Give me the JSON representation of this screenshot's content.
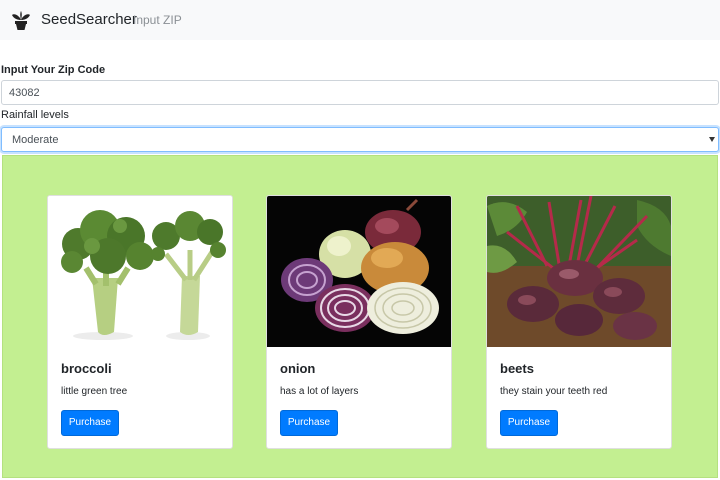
{
  "app": {
    "brand_name": "SeedSearcher",
    "brand_icon": "potted-plant-icon",
    "nav_link": "Input ZIP"
  },
  "form": {
    "zip_label": "Input Your Zip Code",
    "zip_value": "43082",
    "rainfall_label": "Rainfall levels",
    "rainfall_selected": "Moderate"
  },
  "colors": {
    "results_background": "#c3ef91",
    "button": "#007bff",
    "navbar": "#f8f9fa"
  },
  "cards": [
    {
      "title": "broccoli",
      "description": "little green tree",
      "button_label": "Purchase",
      "image": "broccoli-photo"
    },
    {
      "title": "onion",
      "description": "has a lot of layers",
      "button_label": "Purchase",
      "image": "onion-photo"
    },
    {
      "title": "beets",
      "description": "they stain your teeth red",
      "button_label": "Purchase",
      "image": "beets-photo"
    }
  ]
}
